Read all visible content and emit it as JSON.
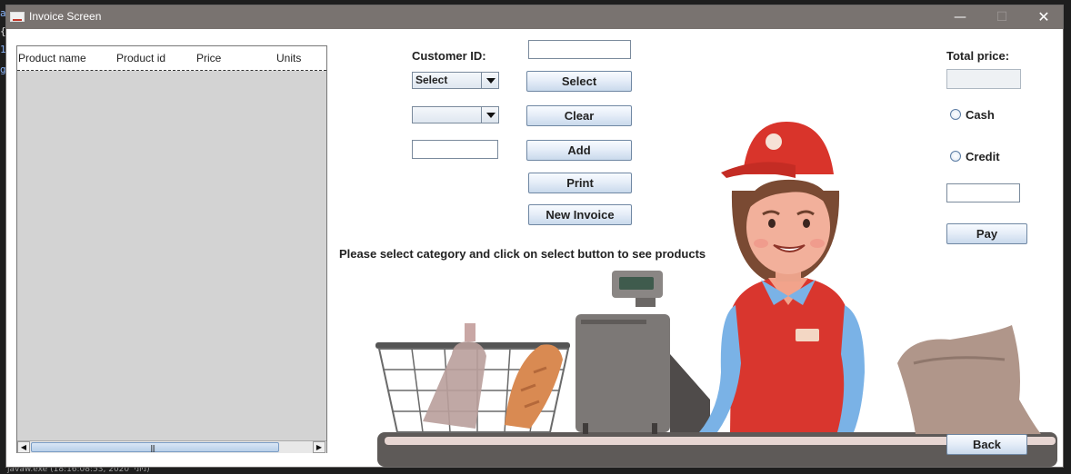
{
  "window": {
    "title": "Invoice Screen",
    "controls": {
      "minimize": "—",
      "maximize": "☐",
      "close": "✕"
    }
  },
  "background": {
    "left_glyphs": [
      "a",
      "{",
      "1",
      "g"
    ],
    "status_text": "javaw.exe (18:16:08:53, 2020 'ניוני)"
  },
  "table": {
    "columns": [
      "Product name",
      "Product id",
      "Price",
      "Units"
    ],
    "rows": [],
    "scroll_left": "◀",
    "scroll_right": "▶",
    "scroll_grip": "|||"
  },
  "form": {
    "customer_id_label": "Customer ID:",
    "customer_id_value": "",
    "category_combo_value": "Select",
    "product_combo_value": "",
    "units_value": "",
    "select_button": "Select",
    "clear_button": "Clear",
    "add_button": "Add",
    "print_button": "Print",
    "new_invoice_button": "New Invoice",
    "hint": "Please select category and click on select button to see products"
  },
  "payment": {
    "total_label": "Total price:",
    "total_value": "",
    "cash_label": "Cash",
    "credit_label": "Credit",
    "amount_value": "",
    "pay_button": "Pay",
    "back_button": "Back"
  },
  "colors": {
    "titlebar": "#797370",
    "table_bg": "#d3d3d3",
    "button_border": "#6f87a3",
    "cashier_cap": "#d9342b",
    "cashier_shirt": "#7ab2e6"
  }
}
